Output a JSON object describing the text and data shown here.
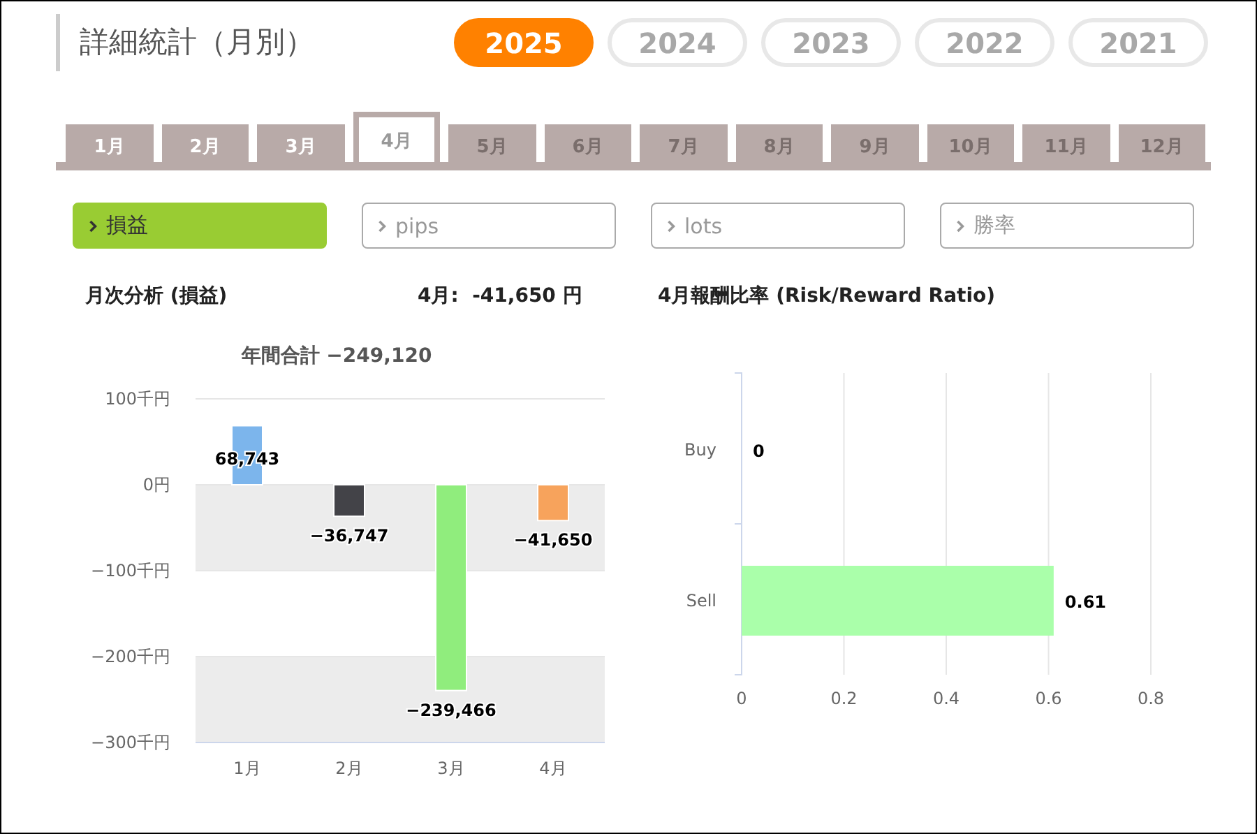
{
  "header": {
    "title": "詳細統計（月別）"
  },
  "years": [
    {
      "label": "2025",
      "selected": true
    },
    {
      "label": "2024",
      "selected": false
    },
    {
      "label": "2023",
      "selected": false
    },
    {
      "label": "2022",
      "selected": false
    },
    {
      "label": "2021",
      "selected": false
    }
  ],
  "month_tabs": [
    {
      "label": "1月",
      "selected": false,
      "disabled": false
    },
    {
      "label": "2月",
      "selected": false,
      "disabled": false
    },
    {
      "label": "3月",
      "selected": false,
      "disabled": false
    },
    {
      "label": "4月",
      "selected": true,
      "disabled": false
    },
    {
      "label": "5月",
      "selected": false,
      "disabled": true
    },
    {
      "label": "6月",
      "selected": false,
      "disabled": true
    },
    {
      "label": "7月",
      "selected": false,
      "disabled": true
    },
    {
      "label": "8月",
      "selected": false,
      "disabled": true
    },
    {
      "label": "9月",
      "selected": false,
      "disabled": true
    },
    {
      "label": "10月",
      "selected": false,
      "disabled": true
    },
    {
      "label": "11月",
      "selected": false,
      "disabled": true
    },
    {
      "label": "12月",
      "selected": false,
      "disabled": true
    }
  ],
  "filters": [
    {
      "label": "損益",
      "selected": true
    },
    {
      "label": "pips",
      "selected": false
    },
    {
      "label": "lots",
      "selected": false
    },
    {
      "label": "勝率",
      "selected": false
    }
  ],
  "monthly": {
    "heading": "月次分析 (損益)",
    "month_label": "4月:",
    "amount": "-41,650",
    "unit": "円",
    "chart_data": {
      "type": "bar",
      "title": "年間合計 −249,120",
      "categories": [
        "1月",
        "2月",
        "3月",
        "4月"
      ],
      "series": [
        {
          "colors": [
            "#7cb5ec",
            "#434348",
            "#90ed7d",
            "#f7a35c"
          ],
          "values": [
            68.7,
            -36.7,
            -239.5,
            -41.7
          ]
        }
      ],
      "value_labels": [
        "68,743",
        "−36,747",
        "−239,466",
        "−41,650"
      ],
      "ylim": [
        -300,
        100
      ],
      "grid": true,
      "yticks": [
        {
          "value": 100,
          "label": "100千円"
        },
        {
          "value": 0,
          "label": "0円"
        },
        {
          "value": -100,
          "label": "−100千円"
        },
        {
          "value": -200,
          "label": "−200千円"
        },
        {
          "value": -300,
          "label": "−300千円"
        }
      ]
    }
  },
  "ratio": {
    "heading": "4月報酬比率 (Risk/Reward Ratio)",
    "chart_data": {
      "type": "bar",
      "orientation": "horizontal",
      "categories": [
        "Buy",
        "Sell"
      ],
      "series": [
        {
          "color": "#aaffaa",
          "values": [
            0,
            0.61
          ]
        }
      ],
      "data_labels": true,
      "grid": true,
      "xlim": [
        0,
        0.8
      ],
      "xticks": [
        0,
        0.2,
        0.4,
        0.6,
        0.8
      ]
    }
  }
}
